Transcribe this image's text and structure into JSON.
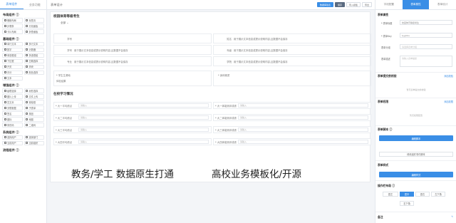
{
  "left_panel": {
    "tabs": [
      "表单组件",
      "业务功能"
    ],
    "groups": [
      {
        "title": "布局组件 ⓘ",
        "items": [
          "栅格布局",
          "标签页",
          "步骤条",
          "分割面板",
          "卡片布局",
          "折叠面板"
        ]
      },
      {
        "title": "基础组件 ⓘ",
        "items": [
          "单行文本",
          "多行文本",
          "数字",
          "计数器",
          "单选框组",
          "多选框组",
          "下拉框",
          "日期选择",
          "开关",
          "滑块",
          "评分",
          "颜色选择",
          "文本"
        ]
      },
      {
        "title": "增强组件 ⓘ",
        "items": [
          "级联选择",
          "树形选择",
          "图片上传",
          "文件上传",
          "富文本",
          "穿梭框",
          "关联数据",
          "子表单",
          "签名",
          "按钮",
          "图标",
          "地图",
          "条形码",
          "二维码"
        ]
      },
      {
        "title": "系统组件 ⓘ",
        "items": [
          "选择用户",
          "选择部门",
          "当前用户",
          "当前组织"
        ]
      },
      {
        "title": "流程组件 ⓘ",
        "items": []
      }
    ]
  },
  "topbar": {
    "title": "表单设计",
    "buttons": [
      "数据库建表",
      "保存",
      "导入模板",
      "导出"
    ]
  },
  "form": {
    "title": "校园体育等级考生",
    "toggle": "全部",
    "rows": [
      {
        "left": "学号",
        "right_label": "姓名",
        "right_hint": "用于展示文本信息或提示说明内容,且数据不会保存"
      },
      {
        "left": "学号",
        "left_hint": "用于展示文本信息或提示说明内容,且数据不会保存",
        "right_label": "年级",
        "right_hint": "用于展示文本信息或提示说明内容,且数据不会保存"
      },
      {
        "left": "专业",
        "left_hint": "用于展示文本信息或提示说明内容,且数据不会保存",
        "right_label": "学院",
        "right_hint": "用于展示文本信息或提示说明内容,且数据不会保存"
      }
    ],
    "extra": {
      "left": "* 学生生源地",
      "left2": "体检结果",
      "right": "* 身体素质"
    },
    "section2": "在校学习情况",
    "fields": [
      {
        "left": "* 大一平均绩点",
        "right": "* 大一体能测评成绩"
      },
      {
        "left": "* 大二平均绩点",
        "right": "* 大二体能测评成绩"
      },
      {
        "left": "* 大三平均绩点",
        "right": "* 大三体能测评成绩"
      },
      {
        "left": "* 大四平均绩点",
        "right": "* 大四体能测评成绩"
      }
    ],
    "placeholder": "请输入"
  },
  "overlay": {
    "left_text": "教务/学工 数据原生打通",
    "right_text": "高校业务模板化/开源"
  },
  "right_panel": {
    "tabs": [
      "字段配置",
      "表单属性",
      "表单设计"
    ],
    "form_attrs": "表单属性",
    "fields": [
      {
        "label": "* 表单标题",
        "value": "校园体育等级考生"
      },
      {
        "label": "* 表单Key",
        "value": "tyjykbs"
      },
      {
        "label": "表单分组",
        "value": "请选择表单分组"
      },
      {
        "label": "表单描述",
        "value": "请输入表单描述"
      }
    ],
    "submit_check": "表单提交前校验",
    "add_rule": "添加校验",
    "empty1": "暂无表单提交前校验",
    "auth": "表单权限",
    "add_auth": "添加权限",
    "empty2": "暂无权限配置",
    "script": "表单脚本 ⓘ",
    "edit_script": "编辑脚本",
    "event_script": "修改组件事件脚本",
    "style": "表单样式",
    "edit_style": "编辑样式",
    "layout": "操作栏布局 ⓘ",
    "layout_opts": [
      "居左",
      "居中",
      "居右",
      "左下角",
      "右下角"
    ],
    "note": "备注"
  }
}
